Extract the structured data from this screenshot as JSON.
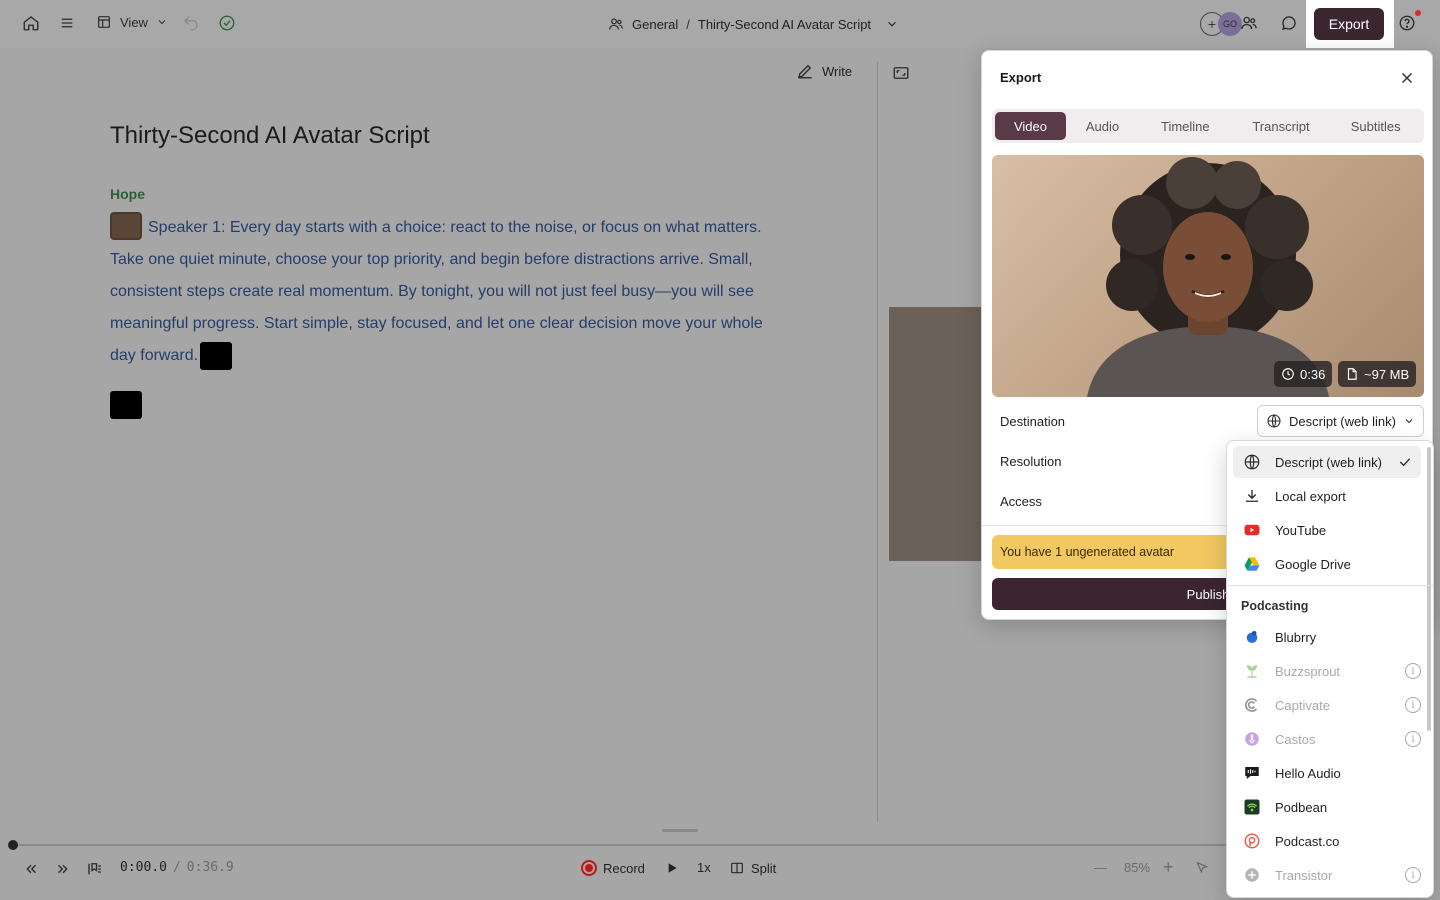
{
  "topbar": {
    "view_label": "View",
    "crumb_workspace": "General",
    "crumb_separator": "/",
    "crumb_project": "Thirty-Second AI Avatar Script",
    "avatar_initials": "GO",
    "export_label": "Export"
  },
  "editor": {
    "write_label": "Write",
    "title": "Thirty-Second AI Avatar Script",
    "speaker": "Hope",
    "script_text": "Speaker 1: Every day starts with a choice: react to the noise, or focus on what matters. Take one quiet minute, choose your top priority, and begin before distractions arrive. Small, consistent steps create real momentum. By tonight, you will not just feel busy—you will see meaningful progress. Start simple, stay focused, and let one clear decision move your whole day forward."
  },
  "transport": {
    "current_time": "0:00.0",
    "time_sep": "/",
    "total_time": "0:36.9",
    "record_label": "Record",
    "speed_label": "1x",
    "split_label": "Split",
    "zoom_label": "85%"
  },
  "export_panel": {
    "title": "Export",
    "tabs": [
      "Video",
      "Audio",
      "Timeline",
      "Transcript",
      "Subtitles"
    ],
    "active_tab": "Video",
    "duration": "0:36",
    "file_size": "~97 MB",
    "destination_label": "Destination",
    "destination_value": "Descript (web link)",
    "resolution_label": "Resolution",
    "access_label": "Access",
    "warning": "You have 1 ungenerated avatar",
    "publish_label": "Publish"
  },
  "dropdown": {
    "items": [
      {
        "label": "Descript (web link)",
        "icon": "globe-icon",
        "selected": true
      },
      {
        "label": "Local export",
        "icon": "download-icon"
      },
      {
        "label": "YouTube",
        "icon": "youtube-icon"
      },
      {
        "label": "Google Drive",
        "icon": "google-drive-icon"
      }
    ],
    "section": "Podcasting",
    "podcasting": [
      {
        "label": "Blubrry",
        "icon": "blubrry-icon",
        "disabled": false
      },
      {
        "label": "Buzzsprout",
        "icon": "buzzsprout-icon",
        "disabled": true
      },
      {
        "label": "Captivate",
        "icon": "captivate-icon",
        "disabled": true
      },
      {
        "label": "Castos",
        "icon": "castos-icon",
        "disabled": true
      },
      {
        "label": "Hello Audio",
        "icon": "hello-audio-icon",
        "disabled": false
      },
      {
        "label": "Podbean",
        "icon": "podbean-icon",
        "disabled": false
      },
      {
        "label": "Podcast.co",
        "icon": "podcast-co-icon",
        "disabled": false
      },
      {
        "label": "Transistor",
        "icon": "transistor-icon",
        "disabled": true
      }
    ],
    "info_glyph": "i"
  },
  "colors": {
    "accent": "#3b2630",
    "active_tab": "#5b3a48",
    "warning": "#f2c862",
    "script_text": "#243d6b",
    "speaker": "#2e5e37"
  }
}
